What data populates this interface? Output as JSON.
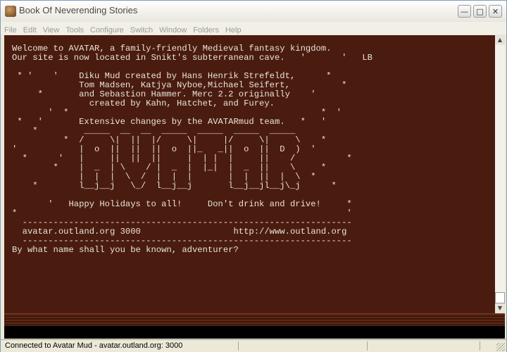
{
  "window": {
    "title": "Book Of Neverending Stories"
  },
  "menu": [
    "File",
    "Edit",
    "View",
    "Tools",
    "Configure",
    "Switch",
    "Window",
    "Folders",
    "Help"
  ],
  "terminal": {
    "lines": [
      "Welcome to AVATAR, a family-friendly Medieval fantasy kingdom.",
      "Our site is now located in Snikt's subterranean cave.   '       '   LB",
      "",
      " * '    '    Diku Mud created by Hans Henrik Strefeldt,      *",
      "             Tom Madsen, Katjya Nyboe,Michael Seifert,          *",
      "     *       and Sebastion Hammer. Merc 2.2 originally    '",
      "               created by Kahn, Hatchet, and Furey.",
      "       '  *                                                 *  '",
      " *   '       Extensive changes by the AVATARmud team.   *   '",
      "    *         _____  __  __  _____  _____  _____  _____",
      "          *  /     \\|  ||  |/     \\|     |/     \\|     \\    *",
      "'            |  o  ||  ||  ||  o  ||_   _||  o  ||  D  )  '",
      "  *      '   |     ||  ||  ||     |  | |  |     ||    /          *",
      "        *    |  _  | \\    / |  _  |  |_|  |  _  ||    \\     *",
      "             |  |  |  \\  /  |  |  |       |  |  ||  |  \\  *",
      "    *        l__j__j   \\_/  l__j__j       l__j__jl__j\\_j      *",
      "",
      "       '   Happy Holidays to all!     Don't drink and drive!     *",
      "*                                                                '",
      "  ----------------------------------------------------------------",
      "  avatar.outland.org 3000                  http://www.outland.org",
      "  ----------------------------------------------------------------",
      "By what name shall you be known, adventurer?"
    ]
  },
  "status": {
    "text": "Connected to Avatar Mud - avatar.outland.org: 3000"
  },
  "colors": {
    "terminal_bg": "#4a1c0f",
    "terminal_fg": "#e9e3d8"
  },
  "icons": {
    "app": "book-icon",
    "minimize": "minimize-icon",
    "maximize": "maximize-icon",
    "close": "close-icon"
  }
}
